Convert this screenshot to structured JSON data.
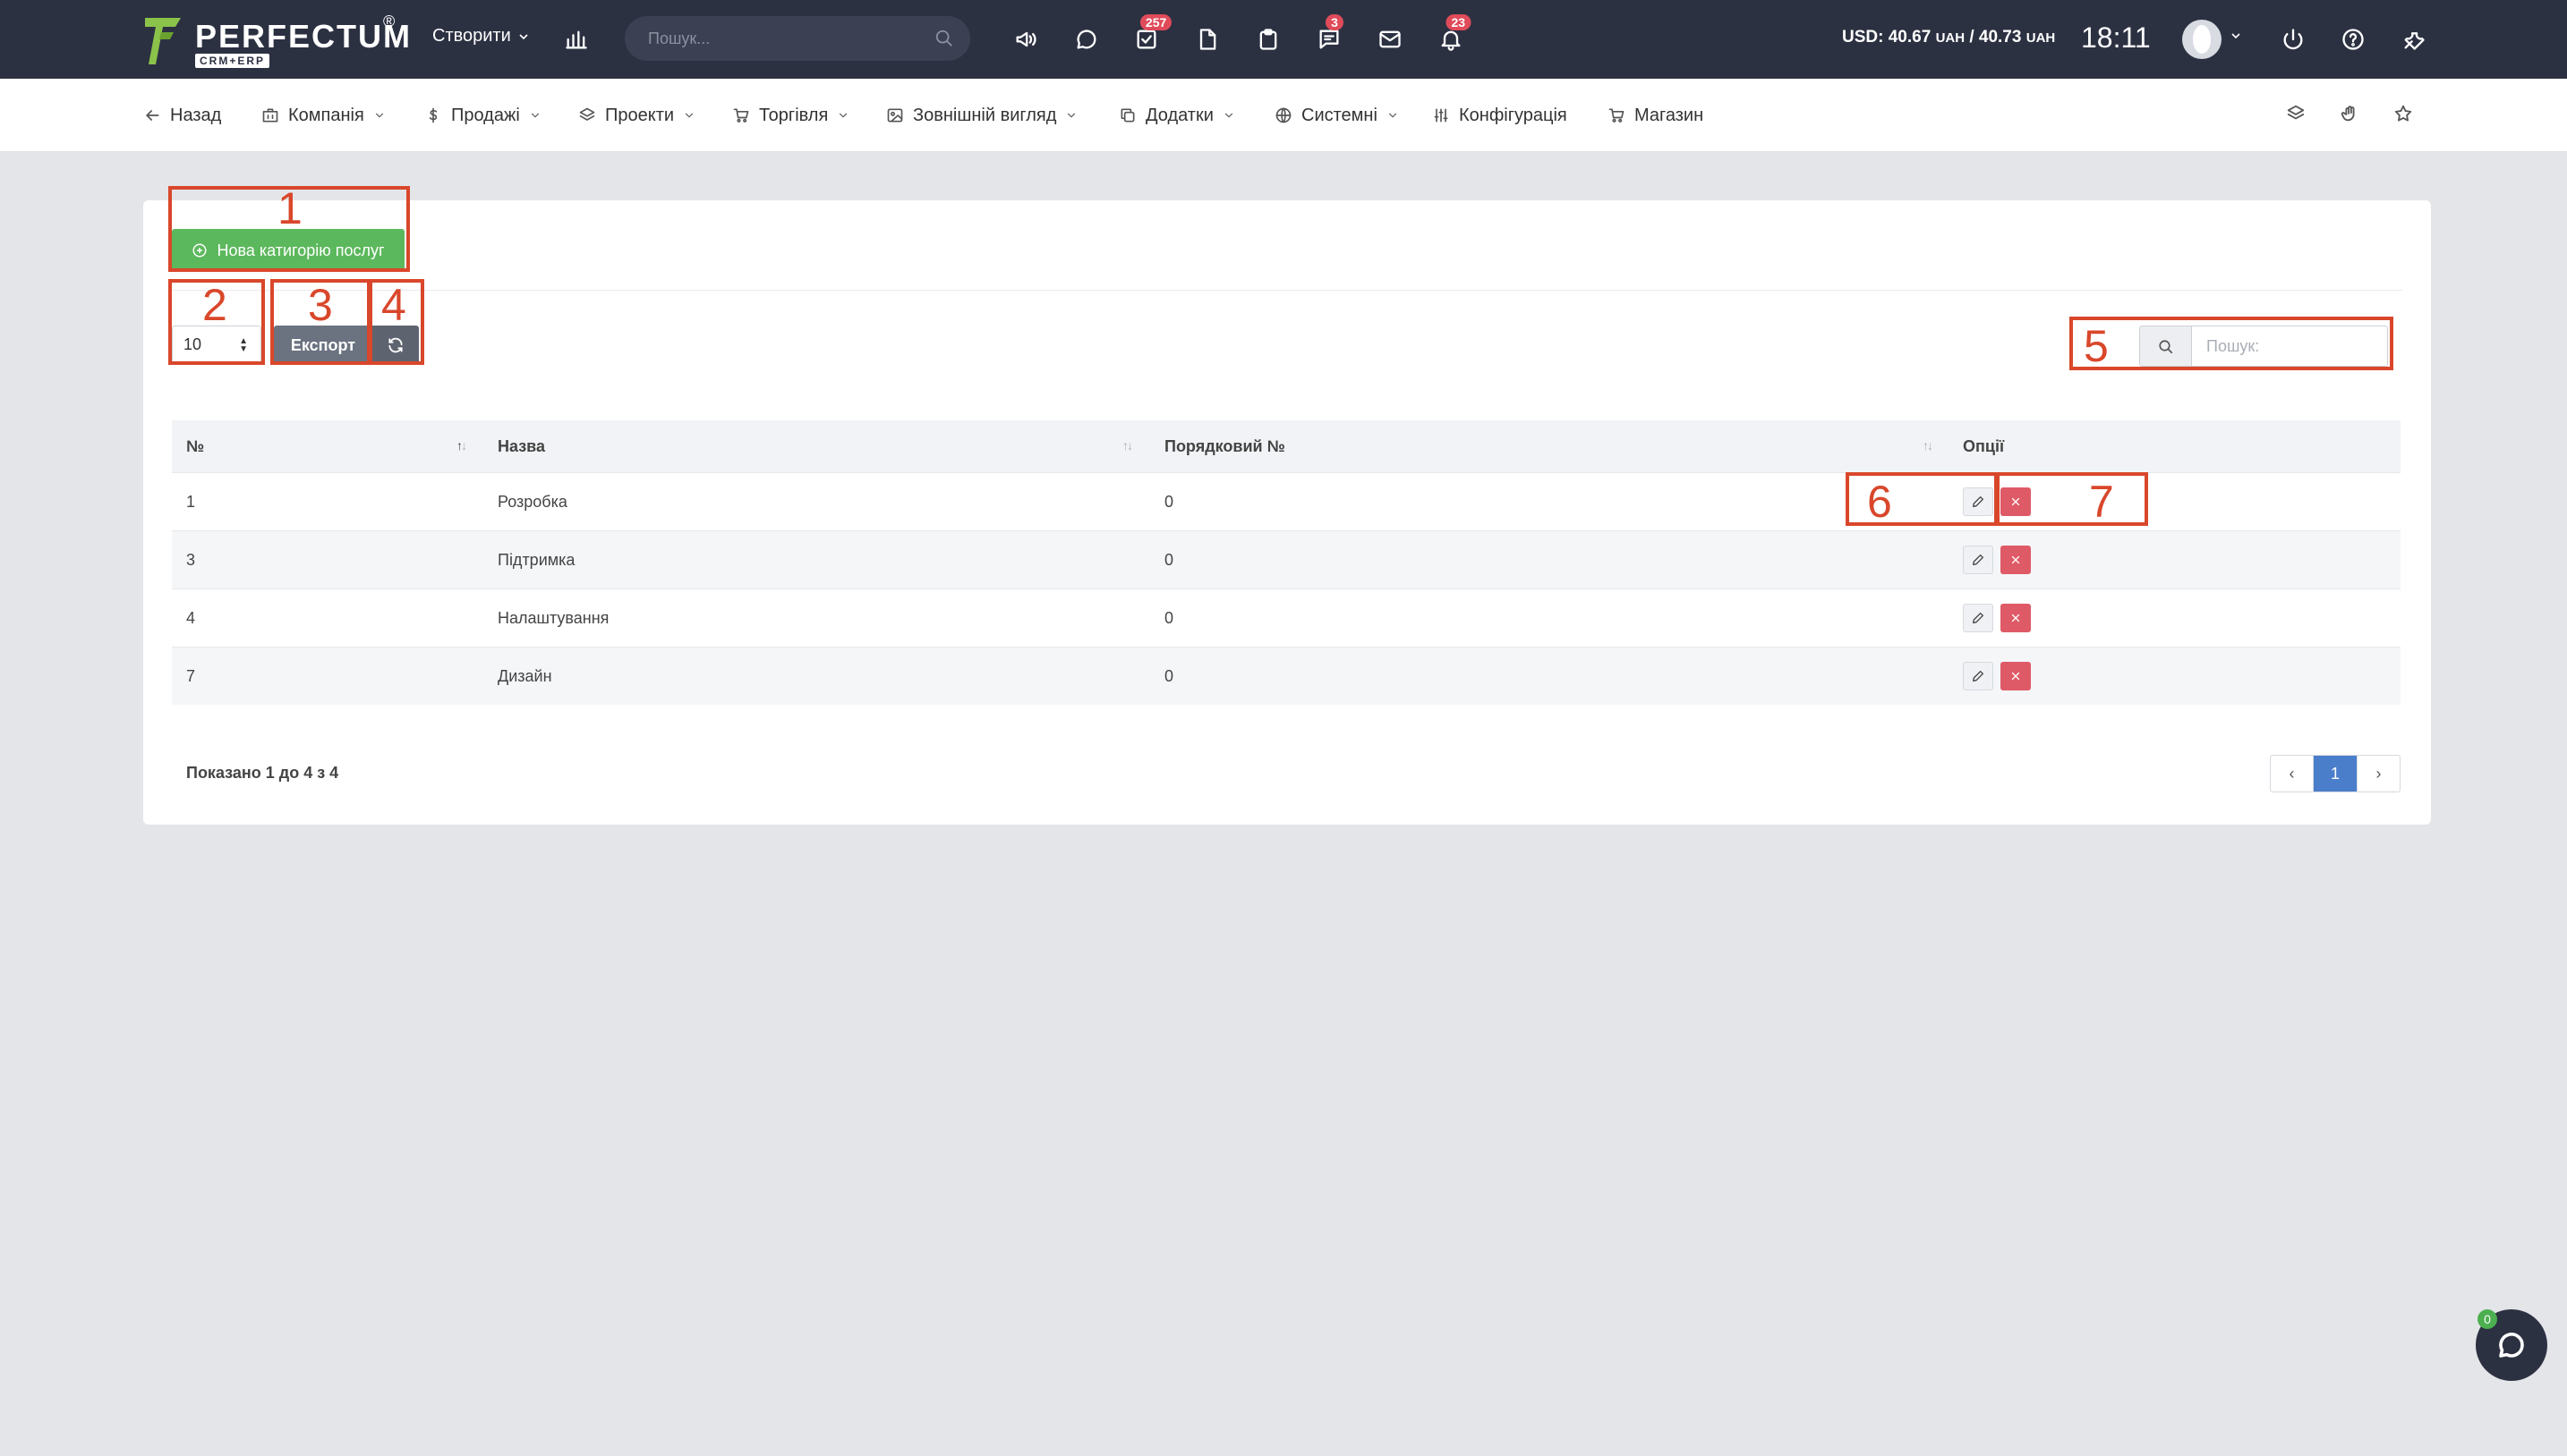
{
  "brand": {
    "name": "PERFECTUM",
    "sub": "CRM+ERP",
    "reg": "®"
  },
  "topbar": {
    "create_label": "Створити",
    "search_placeholder": "Пошук...",
    "badges": {
      "tasks": "257",
      "notes": "3",
      "notifications": "23"
    },
    "currency": {
      "prefix": "USD: 40.67",
      "u1": "UAH",
      "sep": " / 40.73",
      "u2": "UAH"
    },
    "time": "18:11"
  },
  "nav": {
    "back": "Назад",
    "items": [
      "Компанія",
      "Продажі",
      "Проекти",
      "Торгівля",
      "Зовнішній вигляд",
      "Додатки",
      "Системні",
      "Конфігурація",
      "Магазин"
    ]
  },
  "panel": {
    "new_button": "Нова катигорію послуг",
    "page_length": "10",
    "export_label": "Експорт",
    "search_placeholder": "Пошук:"
  },
  "table": {
    "headers": [
      "№",
      "Назва",
      "Порядковий №",
      "Опції"
    ],
    "rows": [
      {
        "id": "1",
        "name": "Розробка",
        "order": "0"
      },
      {
        "id": "3",
        "name": "Підтримка",
        "order": "0"
      },
      {
        "id": "4",
        "name": "Налаштування",
        "order": "0"
      },
      {
        "id": "7",
        "name": "Дизайн",
        "order": "0"
      }
    ]
  },
  "footer": {
    "info": "Показано 1 до 4 з 4",
    "page": "1"
  },
  "annotations": [
    "1",
    "2",
    "3",
    "4",
    "5",
    "6",
    "7"
  ],
  "chat": {
    "badge": "0"
  },
  "colors": {
    "topbar": "#2c3142",
    "success": "#5cb85c",
    "danger": "#df5a67",
    "primary": "#4a7ecb",
    "annotation": "#d9472b"
  }
}
